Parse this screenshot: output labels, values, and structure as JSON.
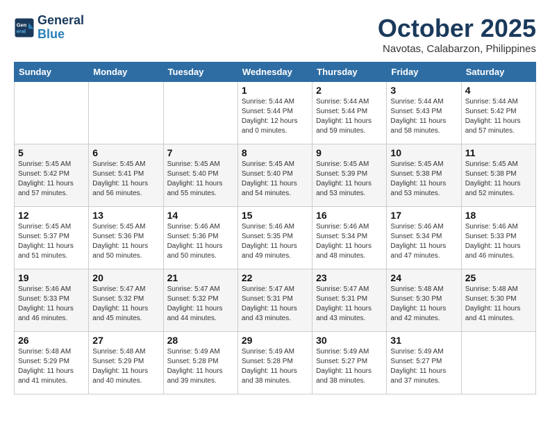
{
  "header": {
    "logo_line1": "General",
    "logo_line2": "Blue",
    "month": "October 2025",
    "location": "Navotas, Calabarzon, Philippines"
  },
  "columns": [
    "Sunday",
    "Monday",
    "Tuesday",
    "Wednesday",
    "Thursday",
    "Friday",
    "Saturday"
  ],
  "weeks": [
    [
      {
        "day": "",
        "sunrise": "",
        "sunset": "",
        "daylight": ""
      },
      {
        "day": "",
        "sunrise": "",
        "sunset": "",
        "daylight": ""
      },
      {
        "day": "",
        "sunrise": "",
        "sunset": "",
        "daylight": ""
      },
      {
        "day": "1",
        "sunrise": "Sunrise: 5:44 AM",
        "sunset": "Sunset: 5:44 PM",
        "daylight": "Daylight: 12 hours and 0 minutes."
      },
      {
        "day": "2",
        "sunrise": "Sunrise: 5:44 AM",
        "sunset": "Sunset: 5:44 PM",
        "daylight": "Daylight: 11 hours and 59 minutes."
      },
      {
        "day": "3",
        "sunrise": "Sunrise: 5:44 AM",
        "sunset": "Sunset: 5:43 PM",
        "daylight": "Daylight: 11 hours and 58 minutes."
      },
      {
        "day": "4",
        "sunrise": "Sunrise: 5:44 AM",
        "sunset": "Sunset: 5:42 PM",
        "daylight": "Daylight: 11 hours and 57 minutes."
      }
    ],
    [
      {
        "day": "5",
        "sunrise": "Sunrise: 5:45 AM",
        "sunset": "Sunset: 5:42 PM",
        "daylight": "Daylight: 11 hours and 57 minutes."
      },
      {
        "day": "6",
        "sunrise": "Sunrise: 5:45 AM",
        "sunset": "Sunset: 5:41 PM",
        "daylight": "Daylight: 11 hours and 56 minutes."
      },
      {
        "day": "7",
        "sunrise": "Sunrise: 5:45 AM",
        "sunset": "Sunset: 5:40 PM",
        "daylight": "Daylight: 11 hours and 55 minutes."
      },
      {
        "day": "8",
        "sunrise": "Sunrise: 5:45 AM",
        "sunset": "Sunset: 5:40 PM",
        "daylight": "Daylight: 11 hours and 54 minutes."
      },
      {
        "day": "9",
        "sunrise": "Sunrise: 5:45 AM",
        "sunset": "Sunset: 5:39 PM",
        "daylight": "Daylight: 11 hours and 53 minutes."
      },
      {
        "day": "10",
        "sunrise": "Sunrise: 5:45 AM",
        "sunset": "Sunset: 5:38 PM",
        "daylight": "Daylight: 11 hours and 53 minutes."
      },
      {
        "day": "11",
        "sunrise": "Sunrise: 5:45 AM",
        "sunset": "Sunset: 5:38 PM",
        "daylight": "Daylight: 11 hours and 52 minutes."
      }
    ],
    [
      {
        "day": "12",
        "sunrise": "Sunrise: 5:45 AM",
        "sunset": "Sunset: 5:37 PM",
        "daylight": "Daylight: 11 hours and 51 minutes."
      },
      {
        "day": "13",
        "sunrise": "Sunrise: 5:45 AM",
        "sunset": "Sunset: 5:36 PM",
        "daylight": "Daylight: 11 hours and 50 minutes."
      },
      {
        "day": "14",
        "sunrise": "Sunrise: 5:46 AM",
        "sunset": "Sunset: 5:36 PM",
        "daylight": "Daylight: 11 hours and 50 minutes."
      },
      {
        "day": "15",
        "sunrise": "Sunrise: 5:46 AM",
        "sunset": "Sunset: 5:35 PM",
        "daylight": "Daylight: 11 hours and 49 minutes."
      },
      {
        "day": "16",
        "sunrise": "Sunrise: 5:46 AM",
        "sunset": "Sunset: 5:34 PM",
        "daylight": "Daylight: 11 hours and 48 minutes."
      },
      {
        "day": "17",
        "sunrise": "Sunrise: 5:46 AM",
        "sunset": "Sunset: 5:34 PM",
        "daylight": "Daylight: 11 hours and 47 minutes."
      },
      {
        "day": "18",
        "sunrise": "Sunrise: 5:46 AM",
        "sunset": "Sunset: 5:33 PM",
        "daylight": "Daylight: 11 hours and 46 minutes."
      }
    ],
    [
      {
        "day": "19",
        "sunrise": "Sunrise: 5:46 AM",
        "sunset": "Sunset: 5:33 PM",
        "daylight": "Daylight: 11 hours and 46 minutes."
      },
      {
        "day": "20",
        "sunrise": "Sunrise: 5:47 AM",
        "sunset": "Sunset: 5:32 PM",
        "daylight": "Daylight: 11 hours and 45 minutes."
      },
      {
        "day": "21",
        "sunrise": "Sunrise: 5:47 AM",
        "sunset": "Sunset: 5:32 PM",
        "daylight": "Daylight: 11 hours and 44 minutes."
      },
      {
        "day": "22",
        "sunrise": "Sunrise: 5:47 AM",
        "sunset": "Sunset: 5:31 PM",
        "daylight": "Daylight: 11 hours and 43 minutes."
      },
      {
        "day": "23",
        "sunrise": "Sunrise: 5:47 AM",
        "sunset": "Sunset: 5:31 PM",
        "daylight": "Daylight: 11 hours and 43 minutes."
      },
      {
        "day": "24",
        "sunrise": "Sunrise: 5:48 AM",
        "sunset": "Sunset: 5:30 PM",
        "daylight": "Daylight: 11 hours and 42 minutes."
      },
      {
        "day": "25",
        "sunrise": "Sunrise: 5:48 AM",
        "sunset": "Sunset: 5:30 PM",
        "daylight": "Daylight: 11 hours and 41 minutes."
      }
    ],
    [
      {
        "day": "26",
        "sunrise": "Sunrise: 5:48 AM",
        "sunset": "Sunset: 5:29 PM",
        "daylight": "Daylight: 11 hours and 41 minutes."
      },
      {
        "day": "27",
        "sunrise": "Sunrise: 5:48 AM",
        "sunset": "Sunset: 5:29 PM",
        "daylight": "Daylight: 11 hours and 40 minutes."
      },
      {
        "day": "28",
        "sunrise": "Sunrise: 5:49 AM",
        "sunset": "Sunset: 5:28 PM",
        "daylight": "Daylight: 11 hours and 39 minutes."
      },
      {
        "day": "29",
        "sunrise": "Sunrise: 5:49 AM",
        "sunset": "Sunset: 5:28 PM",
        "daylight": "Daylight: 11 hours and 38 minutes."
      },
      {
        "day": "30",
        "sunrise": "Sunrise: 5:49 AM",
        "sunset": "Sunset: 5:27 PM",
        "daylight": "Daylight: 11 hours and 38 minutes."
      },
      {
        "day": "31",
        "sunrise": "Sunrise: 5:49 AM",
        "sunset": "Sunset: 5:27 PM",
        "daylight": "Daylight: 11 hours and 37 minutes."
      },
      {
        "day": "",
        "sunrise": "",
        "sunset": "",
        "daylight": ""
      }
    ]
  ]
}
